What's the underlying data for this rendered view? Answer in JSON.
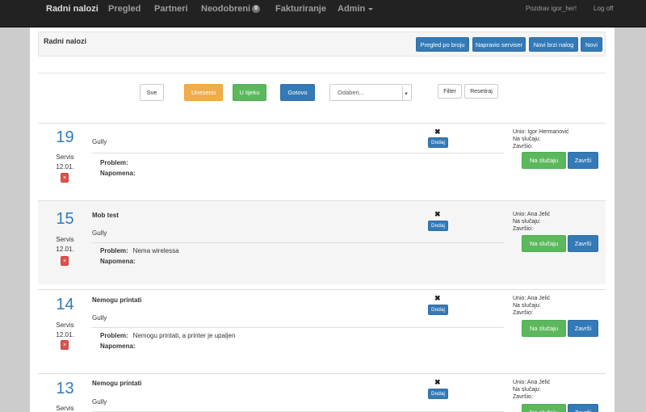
{
  "nav": {
    "items": [
      "Radni nalozi",
      "Pregled",
      "Partneri",
      "Neodobreni",
      "Fakturiranje",
      "Admin"
    ],
    "neodobreni_badge": "0",
    "greeting": "Pozdrav igor_her!",
    "logout": "Log off"
  },
  "header": {
    "title": "Radni nalozi",
    "buttons": [
      "Pregled po broju",
      "Napravio serviser",
      "Novi brzi nalog",
      "Novi"
    ]
  },
  "filters": {
    "all": "Sve",
    "entered": "Uneseno",
    "in_progress": "U tijeku",
    "done": "Gotovo",
    "select_placeholder": "Odaberi...",
    "filter": "Filter",
    "reset": "Resetiraj"
  },
  "labels": {
    "problem": "Problem:",
    "note": "Napomena:",
    "add": "Dodaj",
    "joined": "Unio:",
    "on_case": "Na slučaju:",
    "finished": "Završio:",
    "btn_on_case": "Na slučaju",
    "btn_finish": "Završi",
    "delete": "×"
  },
  "orders": [
    {
      "number": "19",
      "type": "Servis",
      "date": "12.01.",
      "title": "",
      "client": "Gully",
      "problem": "",
      "note": "",
      "joined_by": "Igor Hermanović"
    },
    {
      "number": "15",
      "type": "Servis",
      "date": "12.01.",
      "title": "Mob test",
      "client": "Gully",
      "problem": "Nema wirelessa",
      "note": "",
      "joined_by": "Ana Jelić"
    },
    {
      "number": "14",
      "type": "Servis",
      "date": "12.01.",
      "title": "Nemogu printati",
      "client": "Gully",
      "problem": "Nemogu printati, a printer je upaljen",
      "note": "",
      "joined_by": "Ana Jelić"
    },
    {
      "number": "13",
      "type": "Servis",
      "date": "",
      "title": "Nemogu printati",
      "client": "Gully",
      "problem": "",
      "note": "",
      "joined_by": "Ana Jelić"
    }
  ]
}
